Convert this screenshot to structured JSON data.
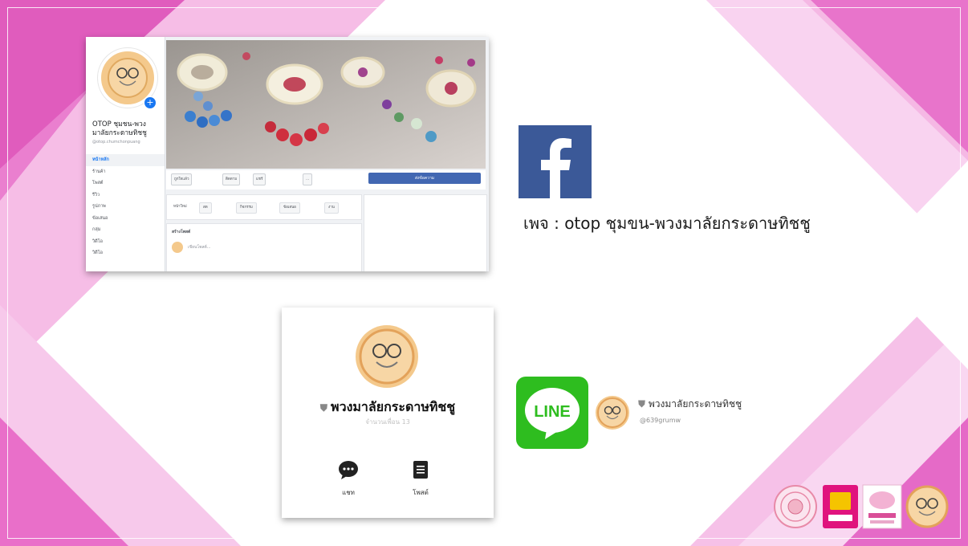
{
  "facebook_screenshot": {
    "page_name": "OTOP ชุมชน-พวงมาลัยกระดาษทิชชู",
    "handle": "@otop.chumchonpuang",
    "nav_items": [
      "หน้าหลัก",
      "ร้านค้า",
      "โพสต์",
      "รีวิว",
      "รูปภาพ",
      "ข้อเสนอ",
      "กลุ่ม",
      "วิดีโอ",
      "วิดีโอ"
    ],
    "toolbar": {
      "liked": "ถูกใจแล้ว",
      "following": "ติดตาม",
      "share": "แชร์",
      "more": "...",
      "send_message": "ส่งข้อความ"
    },
    "actions": [
      "หน้าใหม่",
      "สด",
      "กิจกรรม",
      "ข้อเสนอ",
      "งาน"
    ],
    "create_post_title": "สร้างโพสต์",
    "create_post_placeholder": "เขียนโพสต์..."
  },
  "facebook_label": "เพจ : otop ชุมขน-พวงมาลัยกระดาษทิชชู",
  "line_card": {
    "name": "พวงมาลัยกระดาษทิชชู",
    "friends": "จำนวนเพื่อน 13",
    "chat_label": "แชท",
    "post_label": "โพสต์"
  },
  "line_logo_text": "LINE",
  "line_id": {
    "name": "พวงมาลัยกระดาษทิชชู",
    "handle": "@639grumw"
  },
  "colors": {
    "facebook_blue": "#3b5998",
    "line_green": "#2ebd1f",
    "pink": "#e879c7",
    "light_pink": "#f7c6ea"
  }
}
